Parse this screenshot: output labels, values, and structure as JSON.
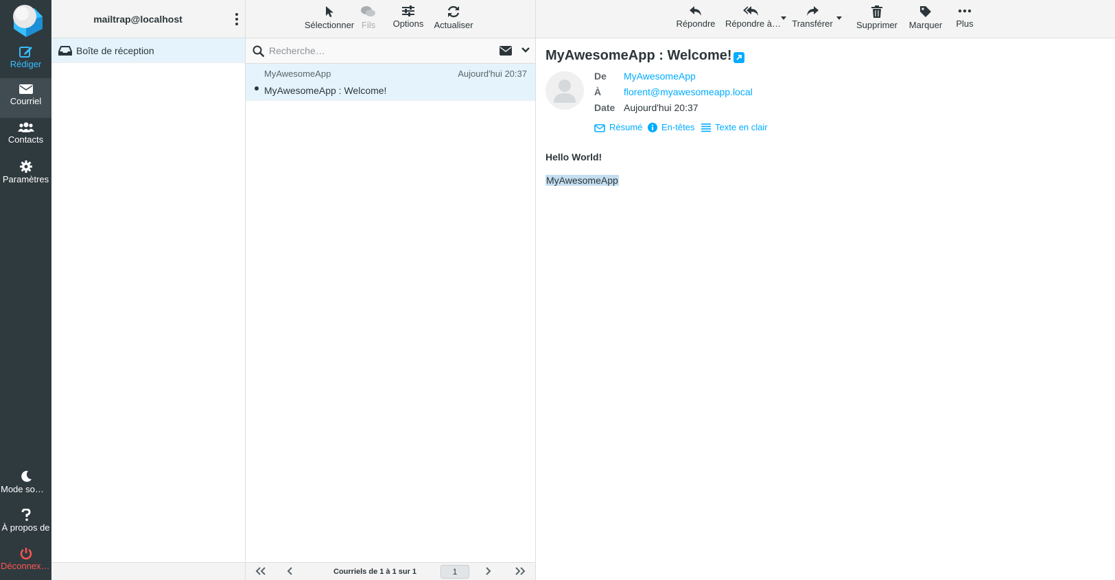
{
  "nav": {
    "compose": "Rédiger",
    "mail": "Courriel",
    "contacts": "Contacts",
    "settings": "Paramètres",
    "dark_mode": "Mode sombre",
    "about": "À propos de",
    "logout": "Déconnexion"
  },
  "folders": {
    "account": "mailtrap@localhost",
    "items": [
      {
        "label": "Boîte de réception",
        "icon": "inbox-icon"
      }
    ]
  },
  "list_toolbar": {
    "select": "Sélectionner",
    "threads": "Fils",
    "options": "Options",
    "refresh": "Actualiser"
  },
  "search": {
    "placeholder": "Recherche…"
  },
  "messages": [
    {
      "from": "MyAwesomeApp",
      "date": "Aujourd'hui 20:37",
      "subject": "MyAwesomeApp : Welcome!",
      "unread": true
    }
  ],
  "pagination": {
    "count": "Courriels de 1 à 1 sur 1",
    "page": "1"
  },
  "view_toolbar": {
    "reply": "Répondre",
    "reply_all": "Répondre à…",
    "forward": "Transférer",
    "delete": "Supprimer",
    "mark": "Marquer",
    "more": "Plus"
  },
  "message": {
    "subject": "MyAwesomeApp : Welcome!",
    "from_label": "De",
    "from": "MyAwesomeApp",
    "to_label": "À",
    "to": "florent@myawesomeapp.local",
    "date_label": "Date",
    "date": "Aujourd'hui 20:37",
    "links": {
      "summary": "Résumé",
      "headers": "En-têtes",
      "plain": "Texte en clair"
    },
    "body_line1": "Hello World!",
    "body_line2": "MyAwesomeApp"
  },
  "colors": {
    "accent": "#00acff",
    "nav_bg": "#2f3a3f",
    "selected_bg": "#e5f4fc",
    "logout": "#ff5552"
  }
}
